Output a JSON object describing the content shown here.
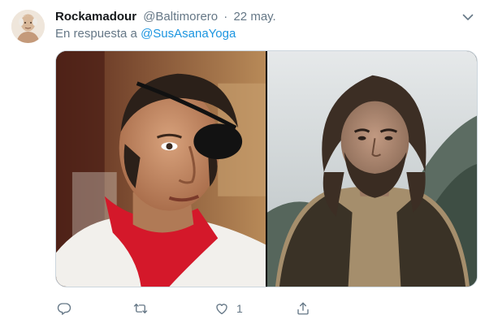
{
  "tweet": {
    "display_name": "Rockamadour",
    "handle": "@Baltimorero",
    "separator": "·",
    "date": "22 may.",
    "reply_prefix": "En respuesta a",
    "reply_mention": "@SusAsanaYoga",
    "media": [
      {
        "icon": "photo-matador-eyepatch"
      },
      {
        "icon": "photo-bearded-man"
      }
    ],
    "actions": {
      "reply_count": "",
      "retweet_count": "",
      "like_count": "1",
      "share_count": ""
    }
  },
  "colors": {
    "text_primary": "#14171a",
    "text_secondary": "#657786",
    "link": "#1b95e0",
    "border": "#ccd6dd"
  }
}
